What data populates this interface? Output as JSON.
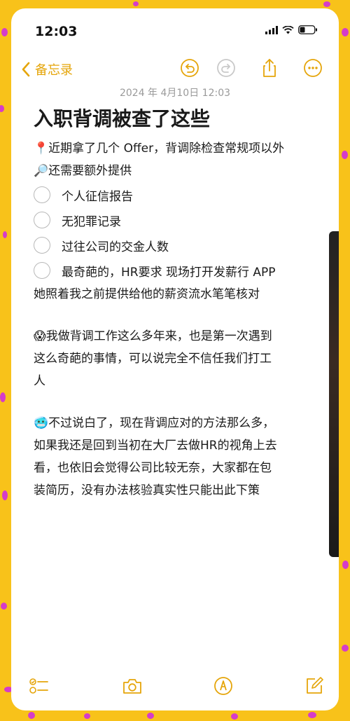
{
  "status_bar": {
    "time": "12:03"
  },
  "nav": {
    "back_label": "备忘录"
  },
  "note": {
    "timestamp": "2024 年 4月10日 12:03",
    "title": "入职背调被查了这些",
    "intro_line1": "📍近期拿了几个 Offer，背调除检查常规项以外",
    "intro_line2": "🔎还需要额外提供",
    "checklist": [
      "个人征信报告",
      "无犯罪记录",
      "过往公司的交金人数",
      "最奇葩的，HR要求 现场打开发薪行 APP"
    ],
    "after_checklist": "她照着我之前提供给他的薪资流水笔笔核对",
    "para2_line1": "😱我做背调工作这么多年来，也是第一次遇到",
    "para2_line2": "这么奇葩的事情，可以说完全不信任我们打工",
    "para2_line3": "人",
    "para3_line1": "🥶不过说白了，现在背调应对的方法那么多，",
    "para3_line2": "如果我还是回到当初在大厂去做HR的视角上去",
    "para3_line3": "看，也依旧会觉得公司比较无奈，大家都在包",
    "para3_line4": "装简历，没有办法核验真实性只能出此下策"
  },
  "colors": {
    "accent": "#e5a50a",
    "background": "#f8c21a",
    "dots": "#d53cc9"
  }
}
